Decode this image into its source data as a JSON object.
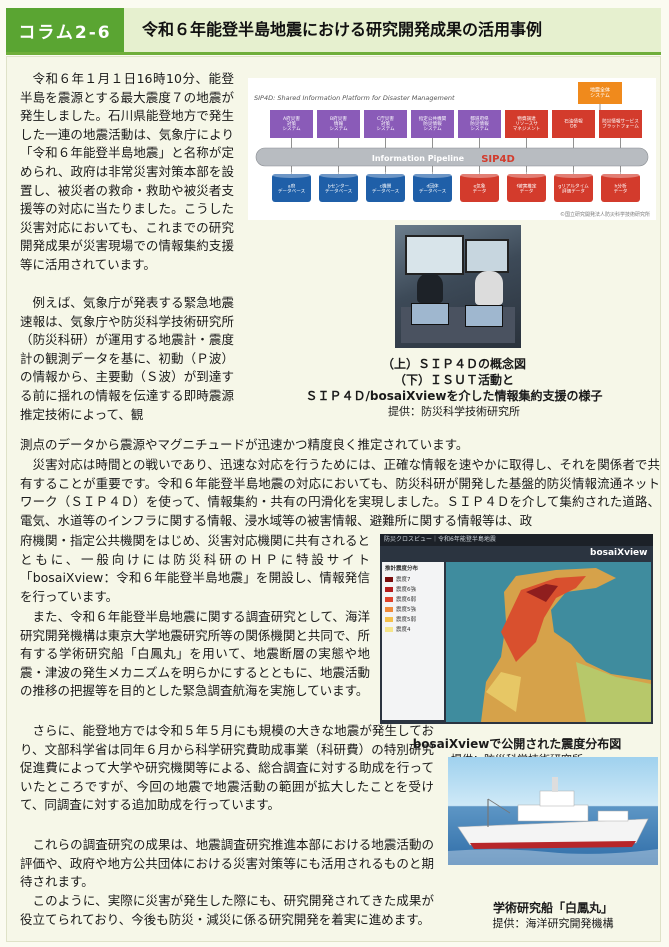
{
  "header": {
    "column_label": "コラム2-6",
    "title": "令和６年能登半島地震における研究開発成果の活用事例"
  },
  "paragraphs": {
    "p1": "令和６年１月１日16時10分、能登半島を震源とする最大震度７の地震が発生しました。石川県能登地方で発生した一連の地震活動は、気象庁により「令和６年能登半島地震」と名称が定められ、政府は非常災害対策本部を設置し、被災者の救命・救助や被災者支援等の対応に当たりました。こうした災害対応においても、これまでの研究開発成果が災害現場での情報集約支援等に活用されています。",
    "p2": "例えば、気象庁が発表する緊急地震速報は、気象庁や防災科学技術研究所（防災科研）が運用する地震計・震度計の観測データを基に、初動（Ｐ波）の情報から、主要動（Ｓ波）が到達する前に揺れの情報を伝達する即時震源推定技術によって、観",
    "p2b": "測点のデータから震源やマグニチュードが迅速かつ精度良く推定されています。",
    "p3a": "災害対応は時間との戦いであり、迅速な対応を行うためには、正確な情報を速やかに取得し、それを関係者で共有することが重要です。令和６年能登半島地震の対応においても、防災科研が開発した基盤的防災情報流通ネットワーク（ＳＩＰ４Ｄ）を使って、情報集約・共有の円滑化を実現しました。ＳＩＰ４Ｄを介して集約された道路、電気、水道等のインフラに関する情報、浸水域等の被害情報、避難所に関する情報等は、政",
    "p3b": "府機関・指定公共機関をはじめ、災害対応機関に共有されるとともに、一般向けには防災科研のＨＰに特設サイト「bosaiXview：令和６年能登半島地震」を開設し、情報発信を行っています。",
    "p4": "また、令和６年能登半島地震に関する調査研究として、海洋研究開発機構は東京大学地震研究所等の関係機関と共同で、所有する学術研究船「白鳳丸」を用いて、地震断層の実態や地震・津波の発生メカニズムを明らかにするとともに、地震活動の推移の把握等を目的とした緊急調査航海を実施しています。",
    "p5": "さらに、能登地方では令和５年５月にも規模の大きな地震が発生しており、文部科学省は同年６月から科学研究費助成事業（科研費）の特別研究促進費によって大学や研究機関等による、総合調査に対する助成を行っていたところですが、今回の地震で地震活動の範囲が拡大したことを受けて、同調査に対する追加助成を行っています。",
    "p6": "これらの調査研究の成果は、地震調査研究推進本部における地震活動の評価や、政府や地方公共団体における災害対策等にも活用されるものと期待されます。",
    "p7": "このように、実際に災害が発生した際にも、研究開発されてきた成果が役立てられており、今後も防災・減災に係る研究開発を着実に進めます。"
  },
  "figure1": {
    "diagram_title": "SIP4D: Shared Information Platform for Disaster Management",
    "top_box": "地震全体\nシステム",
    "systems": [
      "A府災害\n対策\nシステム",
      "B府災害\n情報\nシステム",
      "C庁災害\n対策\nシステム",
      "指定公共機関\n防災情報\nシステム",
      "都道府県\n防災情報\nシステム",
      "物資調達\nリソースサ\nマネジメント",
      "石油情報\nDB",
      "防災情報サービス\nプラットフォーム"
    ],
    "pipeline_label": "Information Pipeline",
    "pipeline_logo": "SIP4D",
    "databases": [
      "a府\nデータベース",
      "bセンター\nデータベース",
      "c機関\nデータベース",
      "d団体\nデータベース",
      "e気象\nデータ",
      "f被害推定\nデータ",
      "gリアルタイム\n評価データ",
      "h分析\nデータ"
    ],
    "copyright": "©国立研究開発法人防災科学技術研究所"
  },
  "caption1": {
    "line1": "（上）ＳＩＰ４Ｄの概念図",
    "line2": "（下）ＩＳＵＴ活動と",
    "line3": "ＳＩＰ４Ｄ/bosaiXviewを介した情報集約支援の様子",
    "credit": "提供：防災科学技術研究所"
  },
  "figure2": {
    "window_title": "防災クロスビュー｜令和6年能登半島地震",
    "logo": "bosaiXview",
    "sidebar_title": "推計震度分布",
    "legend": [
      "震度7",
      "震度6強",
      "震度6弱",
      "震度5強",
      "震度5弱",
      "震度4"
    ]
  },
  "caption2": {
    "line1": "bosaiXviewで公開された震度分布図",
    "credit": "提供：防災科学技術研究所"
  },
  "caption3": {
    "line1": "学術研究船「白鳳丸」",
    "credit": "提供：海洋研究開発機構"
  },
  "colors": {
    "header_green": "#5aa532",
    "header_bg": "#e6f0cf",
    "page_bg": "#f6f7e8",
    "system_purple": "#8a5bb8",
    "db_blue": "#1f5fa8",
    "db_red": "#d33b2c",
    "top_orange": "#f08a1c"
  }
}
